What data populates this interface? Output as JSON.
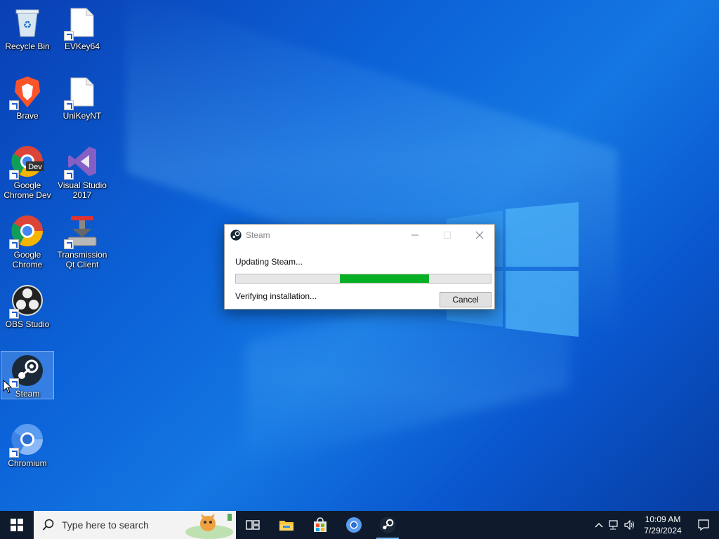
{
  "desktop": {
    "icons": [
      {
        "label": "Recycle Bin",
        "icon": "recycle-bin-icon"
      },
      {
        "label": "EVKey64",
        "icon": "file-icon"
      },
      {
        "label": "Brave",
        "icon": "brave-icon"
      },
      {
        "label": "UniKeyNT",
        "icon": "file-icon"
      },
      {
        "label": "Google Chrome Dev",
        "icon": "chrome-dev-icon",
        "badge": "Dev"
      },
      {
        "label": "Visual Studio 2017",
        "icon": "visual-studio-icon"
      },
      {
        "label": "Google Chrome",
        "icon": "chrome-icon"
      },
      {
        "label": "Transmission Qt Client",
        "icon": "transmission-icon"
      },
      {
        "label": "OBS Studio",
        "icon": "obs-icon"
      },
      {
        "label": "Steam",
        "icon": "steam-icon"
      },
      {
        "label": "Chromium",
        "icon": "chromium-icon"
      }
    ]
  },
  "dialog": {
    "title": "Steam",
    "status": "Updating Steam...",
    "detail": "Verifying installation...",
    "cancel_label": "Cancel",
    "progress_fraction": 0.35
  },
  "taskbar": {
    "search_placeholder": "Type here to search",
    "pinned": [
      "task-view-icon",
      "file-explorer-icon",
      "microsoft-store-icon",
      "chromium-icon",
      "steam-icon"
    ],
    "tray": {
      "time": "10:09 AM",
      "date": "7/29/2024"
    }
  },
  "colors": {
    "progress_fill": "#06b025",
    "taskbar_bg": "#0f1b2d"
  }
}
